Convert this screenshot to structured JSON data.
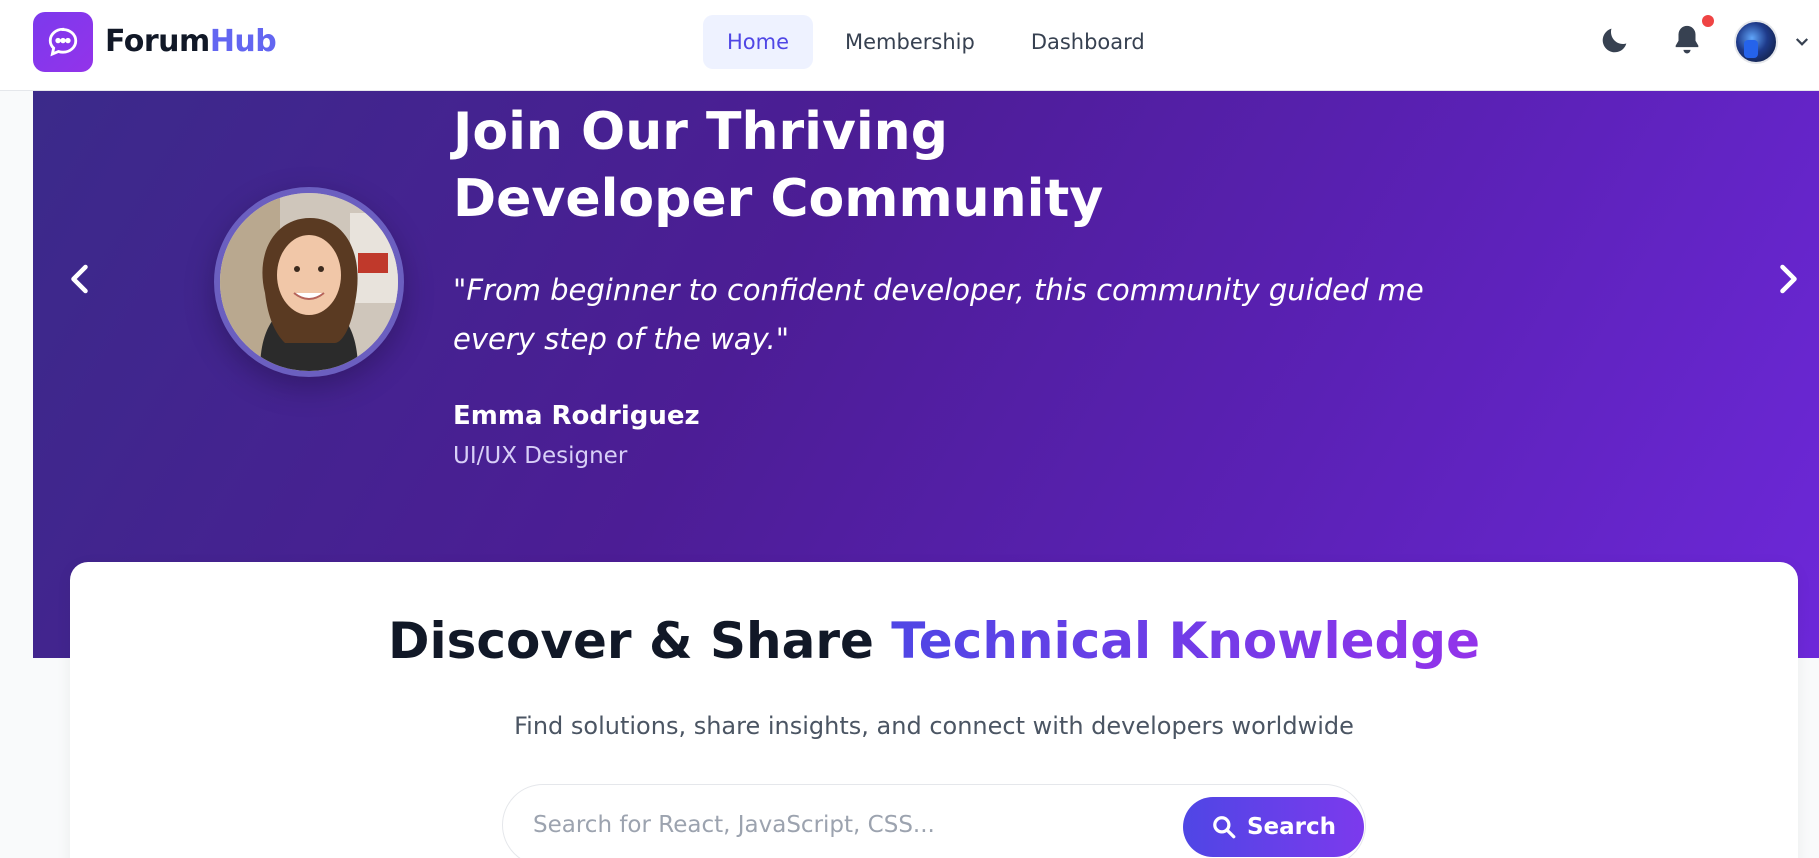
{
  "nav": {
    "brand_main": "Forum",
    "brand_accent": "Hub",
    "links": [
      {
        "label": "Home",
        "active": true
      },
      {
        "label": "Membership",
        "active": false
      },
      {
        "label": "Dashboard",
        "active": false
      }
    ]
  },
  "hero": {
    "title": "Join Our Thriving Developer Community",
    "quote": "\"From beginner to confident developer, this community guided me every step of the way.\"",
    "name": "Emma Rodriguez",
    "role": "UI/UX Designer"
  },
  "search_section": {
    "title_plain": "Discover & Share ",
    "title_accent": "Technical Knowledge",
    "subtitle": "Find solutions, share insights, and connect with developers worldwide",
    "placeholder": "Search for React, JavaScript, CSS...",
    "button_label": "Search"
  },
  "colors": {
    "brand_purple": "#7c3aed",
    "accent_indigo": "#6366f1",
    "hero_start": "#3b2a8a",
    "hero_end": "#6d28d9",
    "notification": "#ef4444"
  },
  "icons": {
    "logo": "chat-bubble-icon",
    "theme": "moon-icon",
    "notifications": "bell-icon",
    "menu": "chevron-down-icon",
    "prev": "chevron-left-icon",
    "next": "chevron-right-icon",
    "search": "search-icon"
  }
}
